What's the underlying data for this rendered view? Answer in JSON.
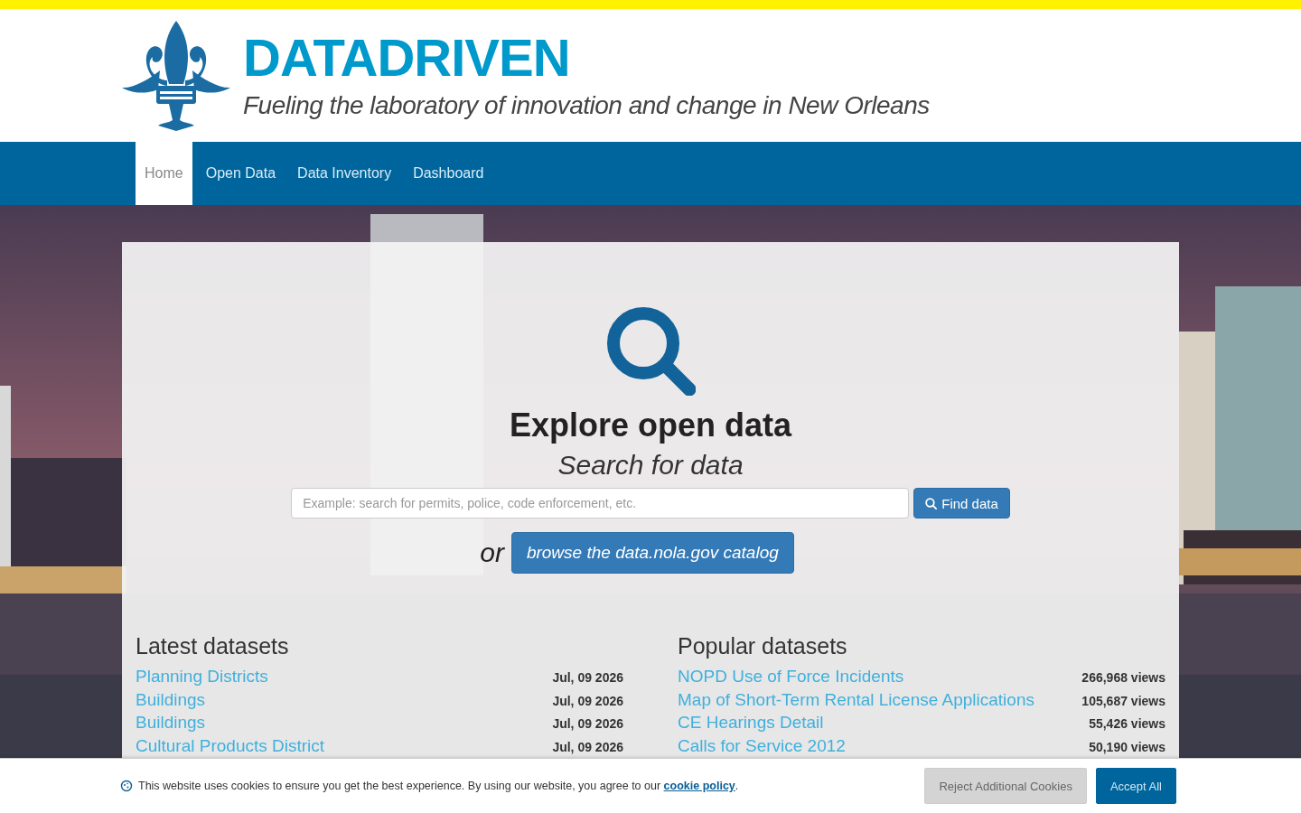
{
  "brand": {
    "title": "DATADRIVEN",
    "tagline": "Fueling the laboratory of innovation and change in New Orleans"
  },
  "nav": [
    {
      "label": "Home",
      "selected": true
    },
    {
      "label": "Open Data",
      "selected": false
    },
    {
      "label": "Data Inventory",
      "selected": false
    },
    {
      "label": "Dashboard",
      "selected": false
    }
  ],
  "hero": {
    "heading": "Explore open data",
    "subheading": "Search for data",
    "search": {
      "placeholder": "Example: search for permits, police, code enforcement, etc."
    },
    "search_button": "Find data",
    "or": "or",
    "browse_button": "browse the data.nola.gov catalog"
  },
  "latest": {
    "title": "Latest datasets",
    "rows": [
      {
        "name": "Planning Districts",
        "date": "Jul, 09 2026"
      },
      {
        "name": "Buildings",
        "date": "Jul, 09 2026"
      },
      {
        "name": "Buildings",
        "date": "Jul, 09 2026"
      },
      {
        "name": "Cultural Products District",
        "date": "Jul, 09 2026"
      }
    ]
  },
  "popular": {
    "title": "Popular datasets",
    "rows": [
      {
        "name": "NOPD Use of Force Incidents",
        "views": "266,968 views"
      },
      {
        "name": "Map of Short-Term Rental License Applications",
        "views": "105,687 views"
      },
      {
        "name": "CE Hearings Detail",
        "views": "55,426 views"
      },
      {
        "name": "Calls for Service 2012",
        "views": "50,190 views"
      }
    ]
  },
  "cookie_bar": {
    "text": "This website uses cookies to ensure you get the best experience. By using our website, you agree to our ",
    "link": "cookie policy",
    "after": ".",
    "buttons": [
      {
        "label": "Reject Additional Cookies",
        "kind": "secondary"
      },
      {
        "label": "Accept All",
        "kind": "primary"
      }
    ]
  }
}
